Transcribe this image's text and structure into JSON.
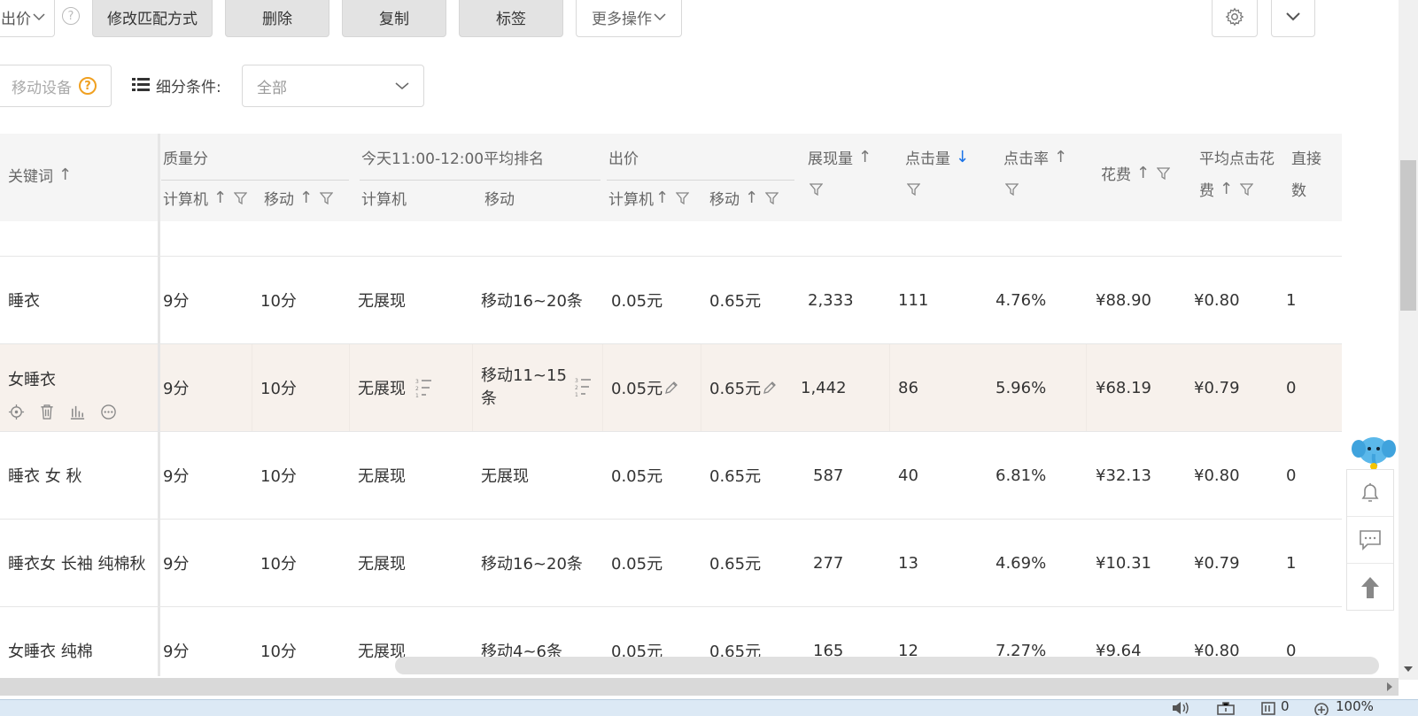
{
  "toolbar": {
    "bid_label": "出价",
    "modify_match": "修改匹配方式",
    "delete": "删除",
    "copy": "复制",
    "tag": "标签",
    "more_ops": "更多操作"
  },
  "filters": {
    "device": "移动设备",
    "segment_label": "细分条件:",
    "segment_value": "全部"
  },
  "headers": {
    "keyword": "关键词",
    "quality": "质量分",
    "rank": "今天11:00-12:00平均排名",
    "bid": "出价",
    "computer": "计算机",
    "mobile": "移动",
    "impressions": "展现量",
    "clicks": "点击量",
    "ctr": "点击率",
    "cost": "花费",
    "avg_cpc_1": "平均点击花",
    "avg_cpc_2": "费",
    "direct_1": "直接",
    "direct_2": "数"
  },
  "rows": [
    {
      "keyword": "睡衣",
      "q_pc": "9分",
      "q_m": "10分",
      "r_pc": "无展现",
      "r_m": "移动16~20条",
      "b_pc": "0.05元",
      "b_m": "0.65元",
      "imp": "2,333",
      "clk": "111",
      "ctr": "4.76%",
      "cost": "¥88.90",
      "cpc": "¥0.80",
      "direct": "1"
    },
    {
      "keyword": "女睡衣",
      "q_pc": "9分",
      "q_m": "10分",
      "r_pc": "无展现",
      "r_m_1": "移动11~15",
      "r_m_2": "条",
      "b_pc": "0.05元",
      "b_m": "0.65元",
      "imp": "1,442",
      "clk": "86",
      "ctr": "5.96%",
      "cost": "¥68.19",
      "cpc": "¥0.79",
      "direct": "0"
    },
    {
      "keyword": "睡衣 女 秋",
      "q_pc": "9分",
      "q_m": "10分",
      "r_pc": "无展现",
      "r_m": "无展现",
      "b_pc": "0.05元",
      "b_m": "0.65元",
      "imp": "587",
      "clk": "40",
      "ctr": "6.81%",
      "cost": "¥32.13",
      "cpc": "¥0.80",
      "direct": "0"
    },
    {
      "keyword": "睡衣女 长袖 纯棉秋",
      "q_pc": "9分",
      "q_m": "10分",
      "r_pc": "无展现",
      "r_m": "移动16~20条",
      "b_pc": "0.05元",
      "b_m": "0.65元",
      "imp": "277",
      "clk": "13",
      "ctr": "4.69%",
      "cost": "¥10.31",
      "cpc": "¥0.79",
      "direct": "1"
    },
    {
      "keyword": "女睡衣 纯棉",
      "q_pc": "9分",
      "q_m": "10分",
      "r_pc": "无展现",
      "r_m": "移动4~6条",
      "b_pc": "0.05元",
      "b_m": "0.65元",
      "imp": "165",
      "clk": "12",
      "ctr": "7.27%",
      "cost": "¥9.64",
      "cpc": "¥0.80",
      "direct": "0"
    }
  ],
  "status": {
    "count": "0",
    "zoom": "100%"
  },
  "icons": {
    "sort_up": "↑",
    "sort_down": "↓",
    "help": "?"
  },
  "colors": {
    "accent_blue": "#1a73e8",
    "help_orange": "#f0a020",
    "highlight_row": "#f7f1ec"
  }
}
